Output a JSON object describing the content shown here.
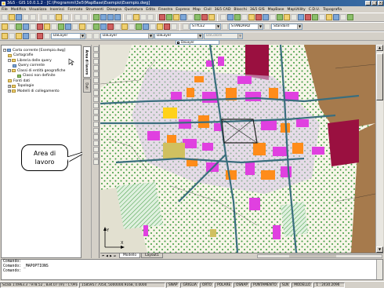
{
  "window": {
    "title": "3&5 · GIS 10.0.1.2 · [C:\\Programmi\\3e5\\MapBase\\Esempio\\Esempio.dwg]",
    "buttons": [
      "_",
      "□",
      "×"
    ]
  },
  "menu": [
    "File",
    "Modifica",
    "Visualizza",
    "Inserisci",
    "Formato",
    "Strumenti",
    "Disegna",
    "Quotatura",
    "Edita",
    "Finestra",
    "Express",
    "Map",
    "Civil",
    "3&5 CAD",
    "Blocchi",
    "3&5 GIS",
    "MapBase",
    "MapUtility",
    "C.D.U.",
    "Topografia"
  ],
  "toolbar2": {
    "text_style": "STYLE2",
    "dim_style": "STANDARD",
    "table_style": "Standard"
  },
  "toolbar3": {
    "layer": "DaLayer",
    "linetype": "DaLayer",
    "lineweight": "DaLayer",
    "plotstyle": "DaColore"
  },
  "toolbar4": {
    "color": "DaLayer"
  },
  "panel": {
    "tabs": [
      "Area di lavoro",
      "Dati"
    ],
    "tree": [
      {
        "label": "Carta corrente [Esempio.dwg]",
        "level": 0,
        "icon": "map-icon"
      },
      {
        "label": "Cartografie",
        "level": 1,
        "icon": "folder-icon"
      },
      {
        "label": "Libreria delle query",
        "level": 1,
        "icon": "folder-icon"
      },
      {
        "label": "Query corrente",
        "level": 2,
        "icon": "query-icon"
      },
      {
        "label": "Classi di entità geografiche",
        "level": 1,
        "icon": "folder-icon"
      },
      {
        "label": "Classi non definite",
        "level": 3,
        "icon": "class-icon"
      },
      {
        "label": "Fonti dati",
        "level": 1,
        "icon": "folder-icon"
      },
      {
        "label": "Topologie",
        "level": 1,
        "icon": "folder-icon"
      },
      {
        "label": "Modelli di collegamento",
        "level": 1,
        "icon": "folder-icon"
      }
    ]
  },
  "callout": {
    "line1": "Area di",
    "line2": "lavoro"
  },
  "layout_tabs": [
    "Modello",
    "Layout1"
  ],
  "command": {
    "lines": [
      "Comando:",
      "Comando: _MAPOPTIONS",
      "Comando:"
    ]
  },
  "status": {
    "scale": "Scala 1:4963.3 : 978.52 , 834.07 (m) : C:\\Program...p\\Esempio\\Esempio",
    "coords": "1585957.7054, 5000000.9168, 0.0000",
    "toggles": [
      "SNAP",
      "GRIGLIA",
      "ORTO",
      "POLARE",
      "OSNAP",
      "PUNTAMENTO",
      "SLN",
      "MODELLO"
    ],
    "zoom": "1 : 2430.2096"
  },
  "colors": {
    "hatch_green": "#3c9a3c",
    "brown_field": "#a67a4c",
    "magenta_building": "#e040e0",
    "road": "#3a6e7e",
    "titlebar": "#0a246a"
  }
}
